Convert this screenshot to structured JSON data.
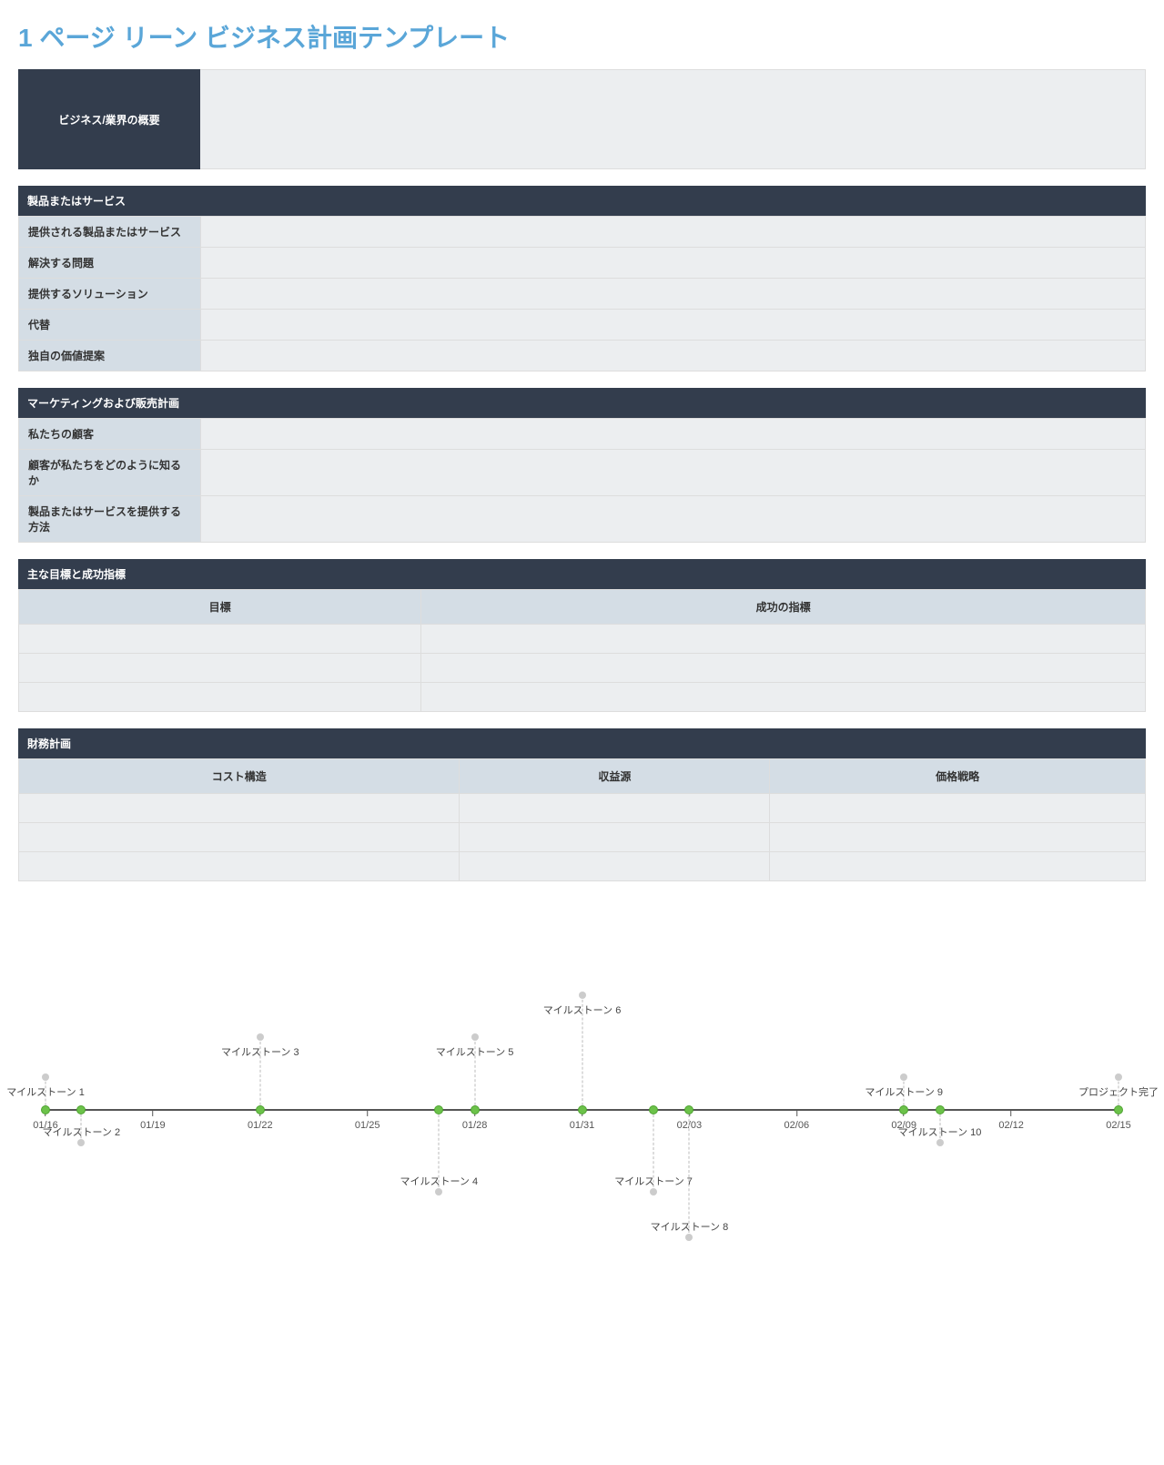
{
  "title": "1 ページ リーン ビジネス計画テンプレート",
  "overview": {
    "label": "ビジネス/業界の概要",
    "content": ""
  },
  "sections": {
    "product": {
      "header": "製品またはサービス",
      "rows": [
        {
          "key": "提供される製品またはサービス",
          "value": ""
        },
        {
          "key": "解決する問題",
          "value": ""
        },
        {
          "key": "提供するソリューション",
          "value": ""
        },
        {
          "key": "代替",
          "value": ""
        },
        {
          "key": "独自の価値提案",
          "value": ""
        }
      ]
    },
    "marketing": {
      "header": "マーケティングおよび販売計画",
      "rows": [
        {
          "key": "私たちの顧客",
          "value": ""
        },
        {
          "key": "顧客が私たちをどのように知るか",
          "value": ""
        },
        {
          "key": "製品またはサービスを提供する方法",
          "value": ""
        }
      ]
    },
    "goals": {
      "header": "主な目標と成功指標",
      "columns": [
        "目標",
        "成功の指標"
      ],
      "rows": 3
    },
    "finance": {
      "header": "財務計画",
      "columns": [
        "コスト構造",
        "収益源",
        "価格戦略"
      ],
      "rows": 3
    }
  },
  "chart_data": {
    "type": "timeline",
    "axis_ticks": [
      "01/16",
      "01/19",
      "01/22",
      "01/25",
      "01/28",
      "01/31",
      "02/03",
      "02/06",
      "02/09",
      "02/12",
      "02/15"
    ],
    "milestones": [
      {
        "label": "マイルストーン 1",
        "date": "01/16",
        "position": "above",
        "offset": 36
      },
      {
        "label": "マイルストーン 2",
        "date": "01/17",
        "position": "below",
        "offset": 36
      },
      {
        "label": "マイルストーン 3",
        "date": "01/22",
        "position": "above",
        "offset": 80
      },
      {
        "label": "マイルストーン 4",
        "date": "01/27",
        "position": "below",
        "offset": 90
      },
      {
        "label": "マイルストーン 5",
        "date": "01/28",
        "position": "above",
        "offset": 80
      },
      {
        "label": "マイルストーン 6",
        "date": "01/31",
        "position": "above",
        "offset": 126
      },
      {
        "label": "マイルストーン 7",
        "date": "02/02",
        "position": "below",
        "offset": 90
      },
      {
        "label": "マイルストーン 8",
        "date": "02/03",
        "position": "below",
        "offset": 140
      },
      {
        "label": "マイルストーン 9",
        "date": "02/09",
        "position": "above",
        "offset": 36
      },
      {
        "label": "マイルストーン 10",
        "date": "02/10",
        "position": "below",
        "offset": 36
      },
      {
        "label": "プロジェクト完了",
        "date": "02/15",
        "position": "above",
        "offset": 36
      }
    ]
  }
}
